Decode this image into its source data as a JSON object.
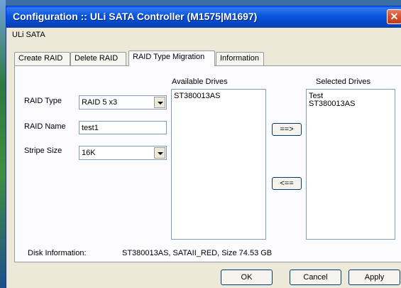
{
  "window": {
    "title": "Configuration :: ULi SATA Controller (M1575|M1697)",
    "close_glyph": "✕"
  },
  "menubar": {
    "label": "ULi SATA"
  },
  "tabs": [
    {
      "label": "Create RAID",
      "active": false
    },
    {
      "label": "Delete RAID",
      "active": false
    },
    {
      "label": "RAID Type Migration",
      "active": true
    },
    {
      "label": "Information",
      "active": false
    }
  ],
  "form": {
    "raid_type_label": "RAID Type",
    "raid_type_value": "RAID 5 x3",
    "raid_name_label": "RAID Name",
    "raid_name_value": "test1",
    "stripe_size_label": "Stripe Size",
    "stripe_size_value": "16K"
  },
  "available": {
    "header": "Available Drives",
    "items": [
      "ST380013AS"
    ]
  },
  "selected": {
    "header": "Selected Drives",
    "items": [
      "Test",
      "ST380013AS"
    ]
  },
  "transfer": {
    "add_label": "==>",
    "remove_label": "<=="
  },
  "disk_info": {
    "label": "Disk Information:",
    "value": "ST380013AS, SATAII_RED, Size 74.53 GB"
  },
  "buttons": {
    "ok": "OK",
    "cancel": "Cancel",
    "apply": "Apply"
  },
  "colors": {
    "titlebar": "#0855dd",
    "close": "#d3502f",
    "dialog_bg": "#ece9d8"
  }
}
